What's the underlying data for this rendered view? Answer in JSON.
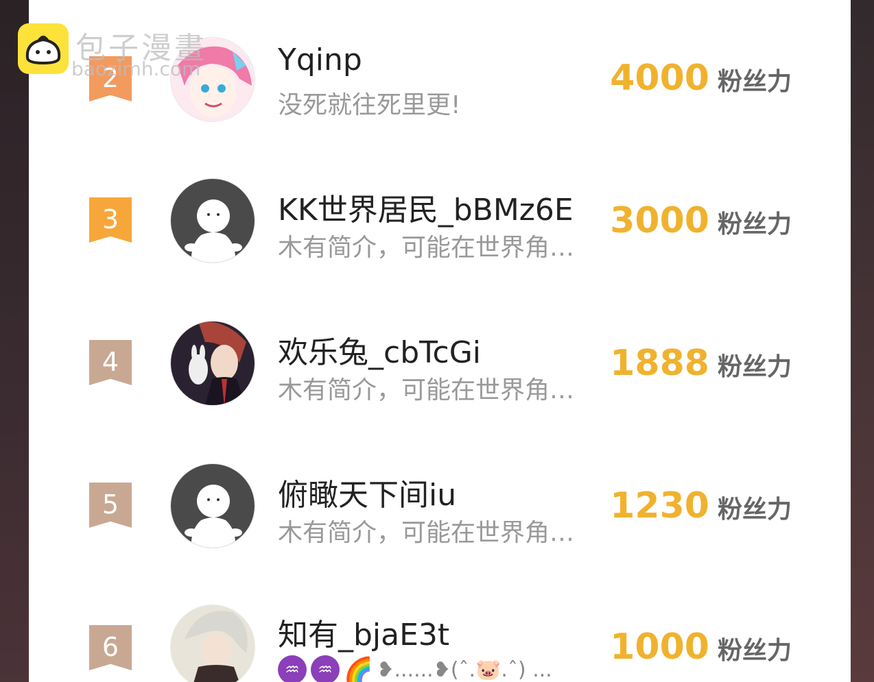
{
  "watermark": {
    "title": "包子漫畫",
    "subtitle": "baozimh.com"
  },
  "unit_label": "粉丝力",
  "rows": [
    {
      "rank": "2",
      "name": "Yqinp",
      "bio": "没死就往死里更!",
      "fans": "4000",
      "rank_color": "#f39a5e",
      "avatar": "anime-pink"
    },
    {
      "rank": "3",
      "name": "KK世界居民_bBMz6E",
      "bio": "木有简介，可能在世界角…",
      "fans": "3000",
      "rank_color": "#f7a73a",
      "avatar": "default"
    },
    {
      "rank": "4",
      "name": "欢乐兔_cbTcGi",
      "bio": "木有简介，可能在世界角…",
      "fans": "1888",
      "rank_color": "#c9a893",
      "avatar": "anime-suit"
    },
    {
      "rank": "5",
      "name": "俯瞰天下间iu",
      "bio": "木有简介，可能在世界角…",
      "fans": "1230",
      "rank_color": "#c9a893",
      "avatar": "default"
    },
    {
      "rank": "6",
      "name": "知有_bjaE3t",
      "bio_emoji_text": "❥......❥(ˆ.🐷.ˆ) ...",
      "fans": "1000",
      "rank_color": "#c9a893",
      "avatar": "anime-white"
    }
  ],
  "emoji": {
    "aquarius": "♒",
    "rainbow": "🌈"
  }
}
